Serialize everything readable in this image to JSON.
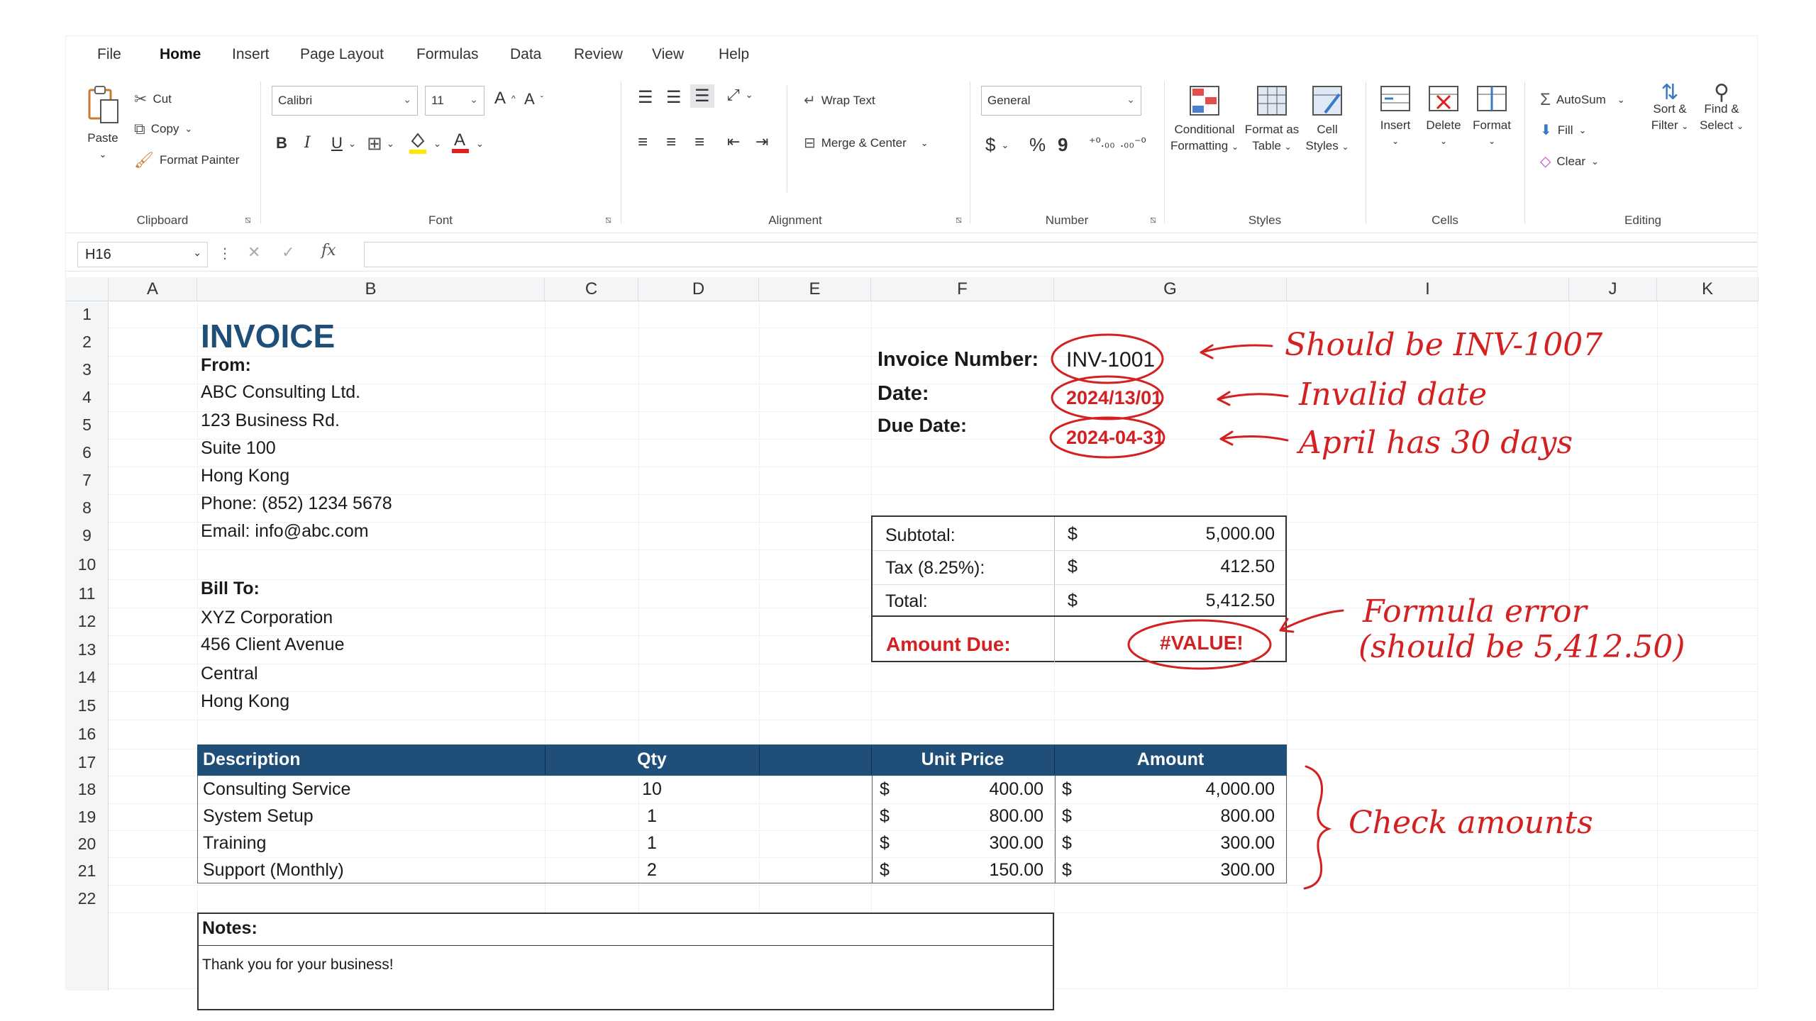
{
  "ribbon_tabs": [
    "File",
    "Home",
    "Insert",
    "Page Layout",
    "Formulas",
    "Data",
    "Review",
    "View",
    "Help"
  ],
  "active_tab": "Home",
  "clipboard": {
    "paste": "Paste",
    "cut": "Cut",
    "copy": "Copy",
    "format_painter": "Format Painter",
    "group": "Clipboard"
  },
  "font": {
    "name": "Calibri",
    "size": "11",
    "bold": "B",
    "italic": "I",
    "underline": "U",
    "group": "Font"
  },
  "alignment": {
    "wrap": "Wrap Text",
    "merge": "Merge & Center",
    "group": "Alignment"
  },
  "number": {
    "format": "General",
    "currency": "$",
    "percent": "%",
    "comma": "9",
    "group": "Number"
  },
  "styles": {
    "conditional": [
      "Conditional",
      "Formatting"
    ],
    "format_table": [
      "Format as",
      "Table"
    ],
    "cell_styles": [
      "Cell",
      "Styles"
    ],
    "group": "Styles"
  },
  "cells": {
    "insert": "Insert",
    "delete": "Delete",
    "format": "Format",
    "group": "Cells"
  },
  "editing": {
    "autosum": "AutoSum",
    "fill": "Fill",
    "clear": "Clear",
    "sort": [
      "Sort &",
      "Filter"
    ],
    "find": [
      "Find &",
      "Select"
    ],
    "group": "Editing"
  },
  "name_box": "H16",
  "fx": "fx",
  "columns": [
    "A",
    "B",
    "C",
    "D",
    "E",
    "F",
    "G",
    "I",
    "J",
    "K"
  ],
  "rows": [
    "1",
    "2",
    "3",
    "4",
    "5",
    "6",
    "7",
    "8",
    "9",
    "10",
    "11",
    "12",
    "13",
    "14",
    "15",
    "16",
    "17",
    "18",
    "19",
    "20",
    "21",
    "22"
  ],
  "invoice": {
    "title": "INVOICE",
    "from_label": "From:",
    "from": [
      "ABC Consulting Ltd.",
      "123 Business Rd.",
      "Suite 100",
      "Hong Kong",
      "Phone: (852) 1234 5678",
      "Email: info@abc.com"
    ],
    "bill_to_label": "Bill To:",
    "bill_to": [
      "XYZ Corporation",
      "456 Client Avenue",
      "Central",
      "Hong Kong"
    ],
    "number_label": "Invoice Number:",
    "number": "INV-1001",
    "date_label": "Date:",
    "date": "2024/13/01",
    "due_label": "Due Date:",
    "due": "2024-04-31"
  },
  "summary": {
    "rows": [
      {
        "label": "Subtotal:",
        "cur": "$",
        "value": "5,000.00"
      },
      {
        "label": "Tax (8.25%):",
        "cur": "$",
        "value": "412.50"
      },
      {
        "label": "Total:",
        "cur": "$",
        "value": "5,412.50"
      }
    ],
    "due_label": "Amount Due:",
    "due_value": "#VALUE!"
  },
  "items": {
    "headers": [
      "Description",
      "Qty",
      "Unit Price",
      "Amount"
    ],
    "rows": [
      {
        "desc": "Consulting Service",
        "qty": "10",
        "cur1": "$",
        "price": "400.00",
        "cur2": "$",
        "amount": "4,000.00"
      },
      {
        "desc": "System Setup",
        "qty": "1",
        "cur1": "$",
        "price": "800.00",
        "cur2": "$",
        "amount": "800.00"
      },
      {
        "desc": "Training",
        "qty": "1",
        "cur1": "$",
        "price": "300.00",
        "cur2": "$",
        "amount": "300.00"
      },
      {
        "desc": "Support (Monthly)",
        "qty": "2",
        "cur1": "$",
        "price": "150.00",
        "cur2": "$",
        "amount": "300.00"
      }
    ]
  },
  "notes": {
    "label": "Notes:",
    "text": "Thank you for your business!"
  },
  "annotations": {
    "inv": "Should be INV-1007",
    "date": "Invalid date",
    "due": "April has 30 days",
    "formula1": "Formula error",
    "formula2": "(should be 5,412.50)",
    "check": "Check amounts"
  },
  "colors": {
    "accent_red": "#d42020",
    "header_blue": "#1f4e79",
    "title_blue": "#1f4e79"
  }
}
